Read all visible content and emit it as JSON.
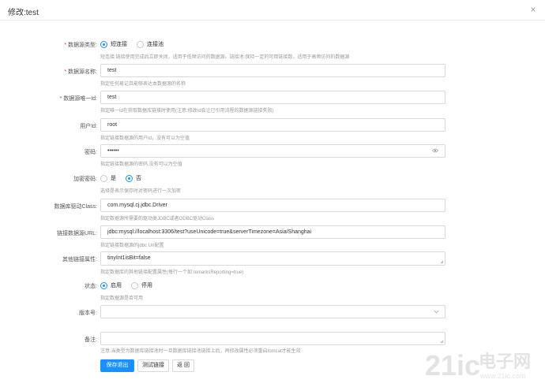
{
  "dialog": {
    "title": "修改:test",
    "close_label": "×"
  },
  "form": {
    "datasource_type": {
      "label": "数据源类型:",
      "options": [
        {
          "label": "短连接",
          "checked": true
        },
        {
          "label": "连接池",
          "checked": false
        }
      ],
      "hint": "短连接:链接使用完成后立即关闭，适用于低频访问的数据源。链接池:保持一定的可用链接数，适用于高频访问的数据源"
    },
    "datasource_name": {
      "label": "数据源名称:",
      "value": "test",
      "hint": "指定任何易记且能够表达本数据源的名称"
    },
    "datasource_id": {
      "label": "数据源唯一Id:",
      "value": "test",
      "hint": "指定唯一Id在获取数据库链接时使用(注意:修改Id会让已引用流程的数据源链接失败)"
    },
    "user_id": {
      "label": "用户Id:",
      "value": "root",
      "hint": "指定链接数据源的用户Id，没有可以为空值"
    },
    "password": {
      "label": "密码:",
      "value": "••••••",
      "hint": "指定链接数据源的密码,没有可以为空值"
    },
    "encrypt_password": {
      "label": "加密密码:",
      "options": [
        {
          "label": "是",
          "checked": false
        },
        {
          "label": "否",
          "checked": true
        }
      ],
      "hint": "选择是表示保存时对密码进行一次加密"
    },
    "driver_class": {
      "label": "数据库驱动Class:",
      "value": "com.mysql.cj.jdbc.Driver",
      "hint": "指定数据源所需要的驱动类JDBC或者ODBC驱动Class"
    },
    "jdbc_url": {
      "label": "链接数据源URL:",
      "value": "jdbc:mysql://localhost:3306/test?useUnicode=true&serverTimezone=Asia/Shanghai",
      "hint": "指定链接数据源的jdbc Url配置"
    },
    "other_props": {
      "label": "其他链接属性:",
      "value": "tinyInt1isBit=false",
      "hint": "指定数据库的其他链接配置属性(每行一个如:remarksReporting=true)"
    },
    "status": {
      "label": "状态:",
      "options": [
        {
          "label": "启用",
          "checked": true
        },
        {
          "label": "停用",
          "checked": false
        }
      ],
      "hint": "指定数据源是否可用"
    },
    "version": {
      "label": "版本号:",
      "value": ""
    },
    "remark": {
      "label": "备注:",
      "value": "",
      "hint": "注意:当类型为数据库链接池时一旦数据库链接池链接上后，再修改属性必须重启tomcat才能生效"
    }
  },
  "buttons": {
    "save": "保存退出",
    "test": "测试链接",
    "back": "返 回"
  },
  "watermark": {
    "text": "21ic",
    "brand": "电子网",
    "url": "www.21ic.com"
  },
  "colors": {
    "primary": "#1890ff",
    "required": "#f5222d",
    "hint": "#999999",
    "border": "#d9d9d9"
  }
}
